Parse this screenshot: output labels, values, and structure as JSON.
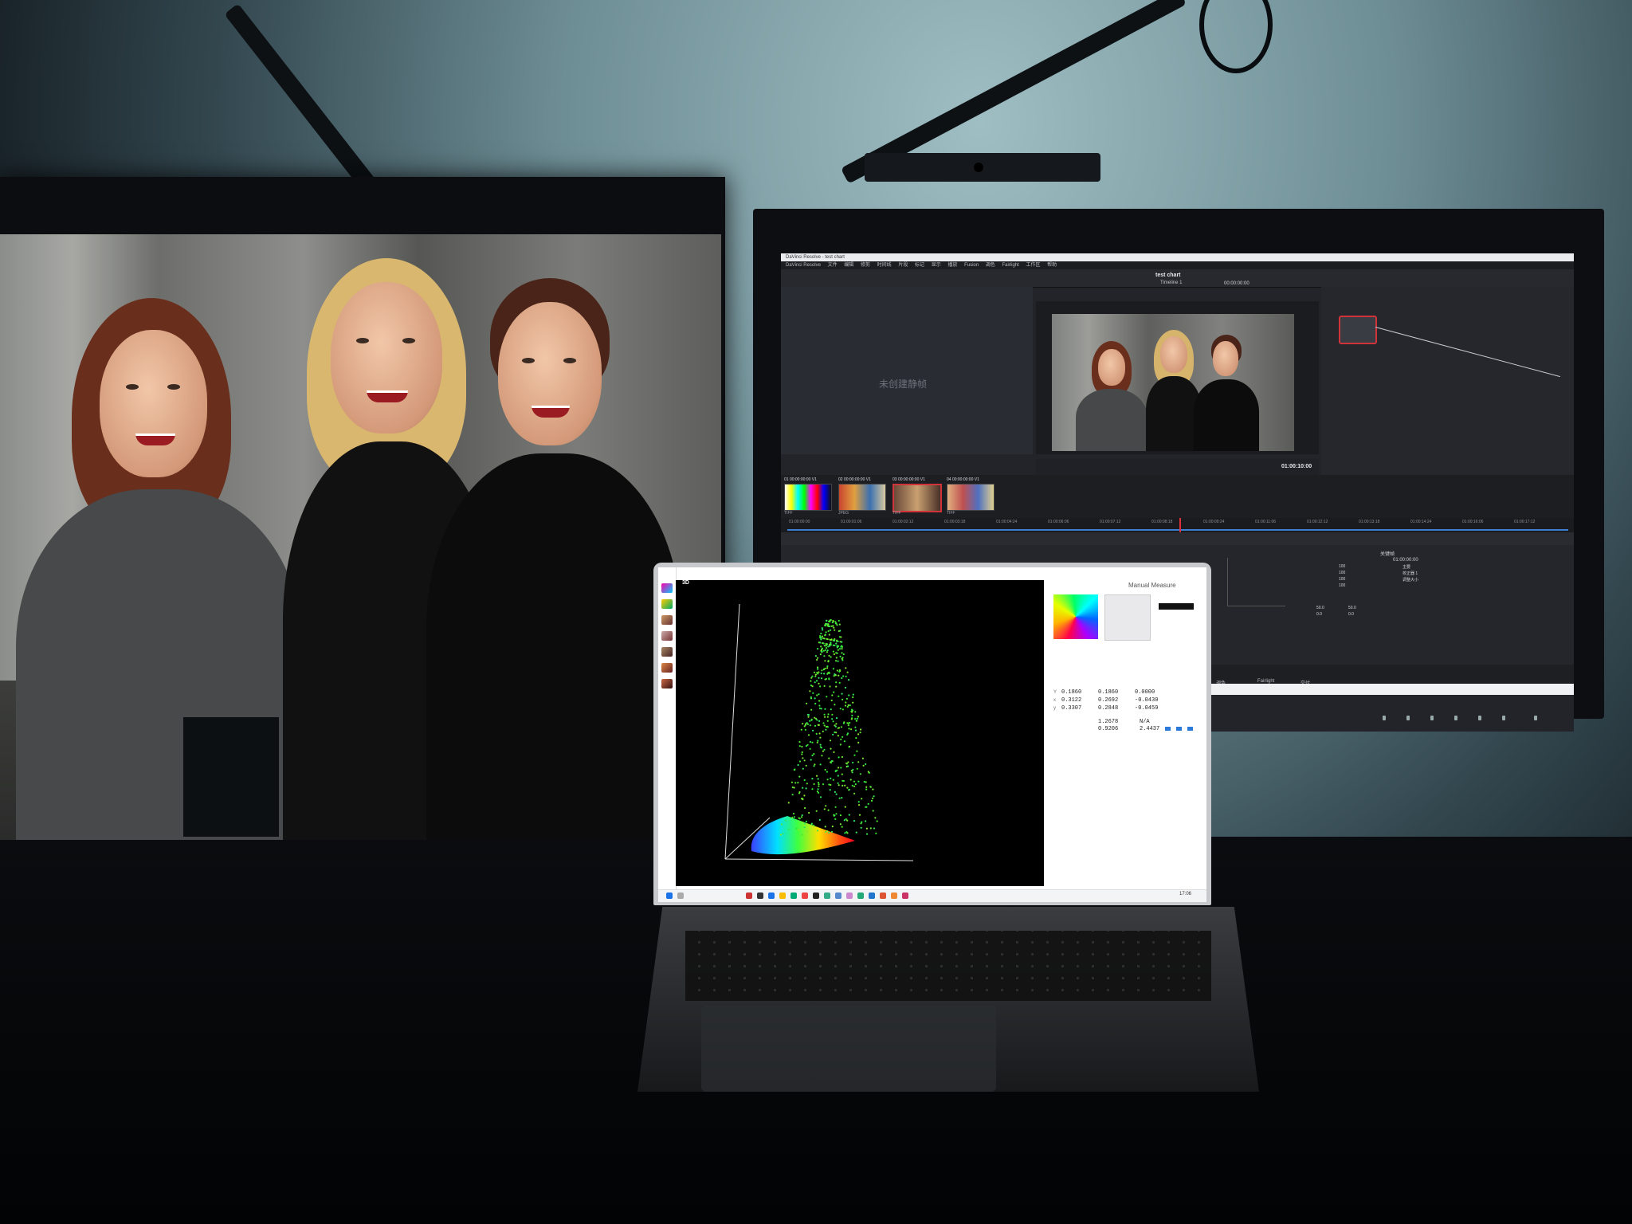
{
  "resolve": {
    "window_title": "DaVinci Resolve - test chart",
    "menu": [
      "DaVinci Resolve",
      "文件",
      "编辑",
      "修剪",
      "时间线",
      "片段",
      "标记",
      "显示",
      "播放",
      "Fusion",
      "调色",
      "Fairlight",
      "工作区",
      "帮助"
    ],
    "project_title": "test chart",
    "timeline_name": "Timeline 1",
    "timecode_top": "00:00:00:00",
    "no_stills": "未创建静帧",
    "viewer_timecode": "01:00:10:00",
    "clips": [
      {
        "label": "01  00:00:00:00  V1",
        "format": "TIFF"
      },
      {
        "label": "02  00:00:00:00  V1",
        "format": "JPEG"
      },
      {
        "label": "03  00:00:00:00  V1",
        "format": "TIFF"
      },
      {
        "label": "04  00:00:00:00  V1",
        "format": "TIFF"
      }
    ],
    "ruler_ticks": [
      "01:00:00:00",
      "01:00:01:06",
      "01:00:02:12",
      "01:00:03:18",
      "01:00:04:24",
      "01:00:06:06",
      "01:00:07:12",
      "01:00:08:18",
      "01:00:09:24",
      "01:00:11:06",
      "01:00:12:12",
      "01:00:13:18",
      "01:00:14:24",
      "01:00:16:06",
      "01:00:17:12"
    ],
    "bottom_labels": [
      "调色",
      "Fairlight",
      "交付"
    ],
    "keyframe_title": "关键帧",
    "keyframe_items": [
      "主要",
      "校正器 1",
      "调整大小"
    ],
    "keyframe_timecode": "01:00:00:00",
    "rgb_values": [
      "100",
      "100",
      "100",
      "100"
    ],
    "adjust_values": [
      "50.0",
      "50.0",
      "0.0",
      "0.0"
    ]
  },
  "laptop": {
    "plot_label": "3D",
    "panel_title": "Manual Measure",
    "measurements": {
      "Y": [
        "0.1860",
        "0.1860",
        "0.0000"
      ],
      "x": [
        "0.3122",
        "0.2692",
        "-0.0430"
      ],
      "y": [
        "0.3307",
        "0.2848",
        "-0.0459"
      ]
    },
    "stats": [
      "1.2678",
      "N/A",
      "0.9206",
      "2.4437"
    ],
    "tray_time": "17:06"
  }
}
